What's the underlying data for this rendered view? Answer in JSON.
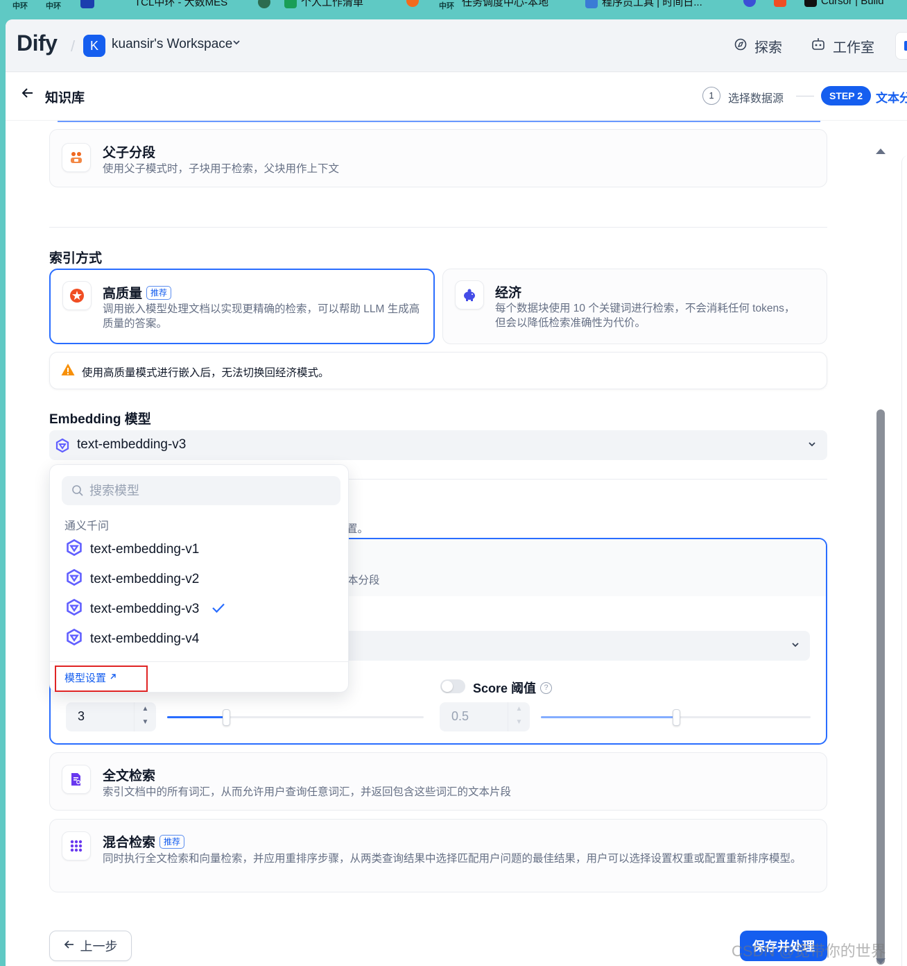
{
  "browser": {
    "bookmarks": [
      {
        "label": "中环",
        "style": "small"
      },
      {
        "label": "中环",
        "style": "small"
      },
      {
        "label": "TCL中环 - 大数MES",
        "style": "normal"
      },
      {
        "label": "个人工作清单",
        "style": "normal"
      },
      {
        "label": "中环",
        "style": "small"
      },
      {
        "label": "任务调度中心-本地",
        "style": "normal"
      },
      {
        "label": "程序员工具 | 时间日...",
        "style": "normal"
      },
      {
        "label": "Cursor | Build",
        "style": "normal"
      }
    ]
  },
  "topbar": {
    "logo": "Dify",
    "workspace_initial": "K",
    "workspace_name": "kuansir's Workspace",
    "nav": [
      {
        "label": "探索",
        "icon": "compass-icon"
      },
      {
        "label": "工作室",
        "icon": "robot-icon"
      }
    ]
  },
  "subbar": {
    "title": "知识库",
    "step1_number": "1",
    "step1_label": "选择数据源",
    "step2_pill": "STEP 2",
    "step2_label": "文本分"
  },
  "parent_child": {
    "title": "父子分段",
    "desc": "使用父子模式时，子块用于检索，父块用作上下文"
  },
  "index": {
    "section_label": "索引方式",
    "high_quality": {
      "title": "高质量",
      "badge": "推荐",
      "desc": "调用嵌入模型处理文档以实现更精确的检索，可以帮助 LLM 生成高质量的答案。",
      "selected": true
    },
    "economy": {
      "title": "经济",
      "desc": "每个数据块使用 10 个关键词进行检索，不会消耗任何 tokens，但会以降低检索准确性为代价。"
    },
    "warning": "使用高质量模式进行嵌入后，无法切换回经济模式。"
  },
  "embedding": {
    "section_label": "Embedding 模型",
    "selected_model": "text-embedding-v3",
    "dropdown": {
      "search_placeholder": "搜索模型",
      "provider": "通义千问",
      "models": [
        "text-embedding-v1",
        "text-embedding-v2",
        "text-embedding-v3",
        "text-embedding-v4"
      ],
      "checked_index": 2,
      "settings_link": "模型设置"
    }
  },
  "retrieval": {
    "partial_hint": "置。",
    "partial_desc": "本分段",
    "top_k_value": "3",
    "top_k_fill": 0.23,
    "score_label": "Score 阈值",
    "score_value": "0.5",
    "score_fill": 0.5,
    "score_enabled": false,
    "fulltext": {
      "title": "全文检索",
      "desc": "索引文档中的所有词汇，从而允许用户查询任意词汇，并返回包含这些词汇的文本片段"
    },
    "hybrid": {
      "title": "混合检索",
      "badge": "推荐",
      "desc": "同时执行全文检索和向量检索，并应用重排序步骤，从两类查询结果中选择匹配用户问题的最佳结果，用户可以选择设置权重或配置重新排序模型。"
    }
  },
  "footer": {
    "back_label": "上一步",
    "save_label": "保存并处理"
  },
  "watermark": "CSDN @宽带你的世界",
  "colors": {
    "accent": "#155eef",
    "selected_border": "#296dff",
    "warning": "#f79009",
    "annotation_red": "#e02424",
    "browser_bar": "#5fc9c4"
  }
}
